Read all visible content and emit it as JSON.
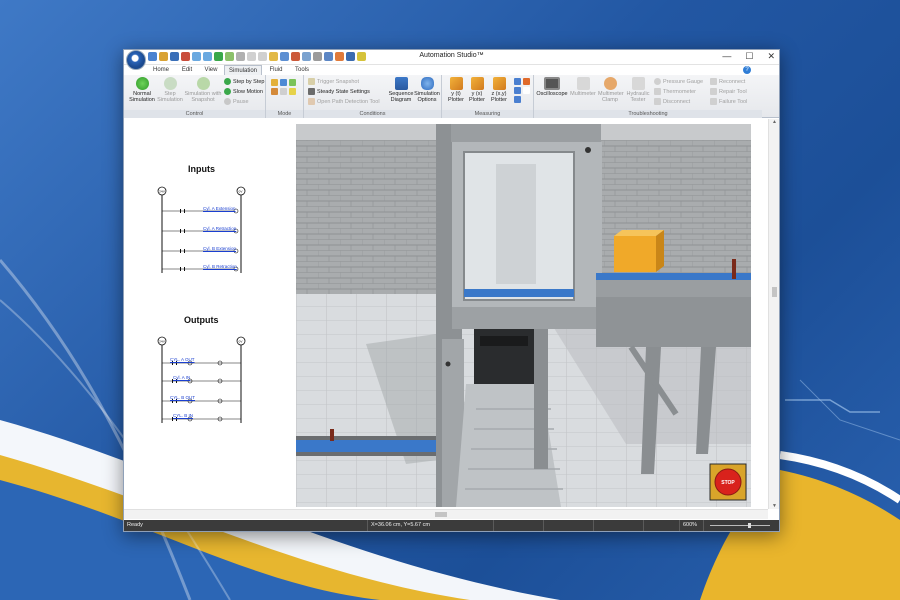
{
  "window": {
    "title": "Automation Studio™",
    "controls": [
      "—",
      "☐",
      "✕"
    ]
  },
  "tabs": [
    "Home",
    "Edit",
    "View",
    "Simulation",
    "Fluid",
    "Tools"
  ],
  "active_tab": "Simulation",
  "ribbon": {
    "control": {
      "label": "Control",
      "normal_simulation": "Normal Simulation",
      "step": "Step Simulation",
      "simulation_with_snapshot": "Simulation with Snapshot",
      "step_by_step": "Step by Step",
      "slow_motion": "Slow Motion",
      "pause": "Pause"
    },
    "mode": {
      "label": "Mode"
    },
    "conditions": {
      "label": "Conditions",
      "trigger_snapshot": "Trigger Snapshot",
      "steady_state_settings": "Steady State Settings",
      "open_path_detection_tool": "Open Path Detection Tool",
      "sequence_diagram": "Sequence Diagram",
      "simulation_options": "Simulation Options"
    },
    "measuring": {
      "label": "Measuring",
      "yf_plotter": "y (t) Plotter",
      "yx_plotter": "y (x) Plotter",
      "zxy_plotter": "z (x,y) Plotter"
    },
    "troubleshooting": {
      "label": "Troubleshooting",
      "oscilloscope": "Oscilloscope",
      "multimeter": "Multimeter",
      "multimeter_clamp": "Multimeter Clamp",
      "hydraulic_tester": "Hydraulic Tester",
      "pressure_gauge": "Pressure Gauge",
      "thermometer": "Thermometer",
      "disconnect": "Disconnect",
      "reconnect": "Reconnect",
      "repair_tool": "Repair Tool",
      "failure_tool": "Failure Tool"
    }
  },
  "inputs": {
    "title": "Inputs",
    "rail_left": "24V",
    "rail_right": "0V",
    "rungs": [
      "Cyl. A Extension",
      "Cyl. A Retraction",
      "Cyl. B Extension",
      "Cyl. B Retraction"
    ]
  },
  "outputs": {
    "title": "Outputs",
    "rail_left": "24V",
    "rail_right": "0V",
    "rungs": [
      "CYL. A OUT",
      "Cyl. A IN",
      "CYL. B OUT",
      "CYL. B IN"
    ]
  },
  "stop_button": "STOP",
  "status": {
    "state": "Ready",
    "coords": "X=36.06 cm, Y=5.67 cm",
    "zoom": "600%"
  },
  "colors": {
    "accent": "#2a64b8",
    "status_bar": "#3b3b3b",
    "link": "#1a3fd0",
    "stop": "#d9221c"
  }
}
